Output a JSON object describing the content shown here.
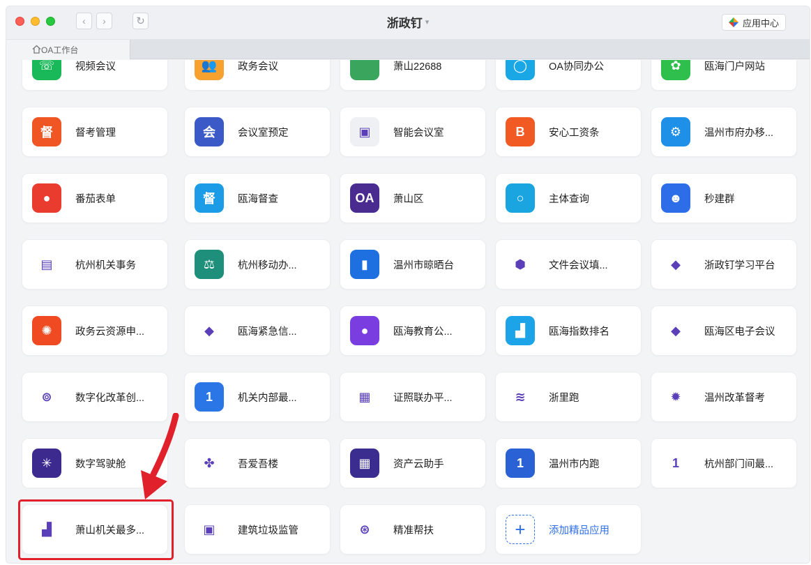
{
  "window": {
    "title": "浙政钉",
    "app_center_label": "应用中心",
    "nav_back": "‹",
    "nav_forward": "›",
    "nav_reload": "↻"
  },
  "tab": {
    "label": "OA工作台"
  },
  "colors": {
    "accent_blue": "#2f6fe8",
    "highlight_red": "#e0202a"
  },
  "apps": [
    {
      "label": "视频会议",
      "icon": "video-meeting-icon",
      "color": "#19b95a",
      "glyph": "☏"
    },
    {
      "label": "政务会议",
      "icon": "gov-meeting-icon",
      "color": "#f7a12e",
      "glyph": "👥"
    },
    {
      "label": "萧山22688",
      "icon": "xiaoshan-22688-icon",
      "color": "#3aa55d",
      "glyph": ""
    },
    {
      "label": "OA协同办公",
      "icon": "oa-collab-icon",
      "color": "#1aa7e6",
      "glyph": "◯"
    },
    {
      "label": "瓯海门户网站",
      "icon": "ouhai-portal-icon",
      "color": "#2fbf4c",
      "glyph": "✿"
    },
    {
      "label": "督考管理",
      "icon": "supervision-icon",
      "color": "#f05524",
      "glyph": "督"
    },
    {
      "label": "会议室预定",
      "icon": "meeting-room-icon",
      "color": "#3b5ac8",
      "glyph": "会"
    },
    {
      "label": "智能会议室",
      "icon": "smart-meeting-icon",
      "color": "#eef0f3",
      "glyph": "▣"
    },
    {
      "label": "安心工资条",
      "icon": "payslip-icon",
      "color": "#f25a24",
      "glyph": "B"
    },
    {
      "label": "温州市府办移...",
      "icon": "wenzhou-gov-icon",
      "color": "#1e90e8",
      "glyph": "⚙"
    },
    {
      "label": "番茄表单",
      "icon": "tomato-form-icon",
      "color": "#ea3b2f",
      "glyph": "●"
    },
    {
      "label": "瓯海督查",
      "icon": "ouhai-inspect-icon",
      "color": "#1c9be6",
      "glyph": "督"
    },
    {
      "label": "萧山区",
      "icon": "xiaoshan-district-icon",
      "color": "#4a2b8f",
      "glyph": "OA"
    },
    {
      "label": "主体查询",
      "icon": "entity-search-icon",
      "color": "#1aa5e0",
      "glyph": "○"
    },
    {
      "label": "秒建群",
      "icon": "quick-group-icon",
      "color": "#2d6ee8",
      "glyph": "☻"
    },
    {
      "label": "杭州机关事务",
      "icon": "hangzhou-affairs-icon",
      "color": "#ffffff",
      "glyph": "▤"
    },
    {
      "label": "杭州移动办...",
      "icon": "hangzhou-mobile-icon",
      "color": "#1d8f7a",
      "glyph": "⚖"
    },
    {
      "label": "温州市晾晒台",
      "icon": "wenzhou-display-icon",
      "color": "#1e6fe0",
      "glyph": "▮"
    },
    {
      "label": "文件会议填...",
      "icon": "file-meeting-icon",
      "color": "#ffffff",
      "glyph": "⬢"
    },
    {
      "label": "浙政钉学习平台",
      "icon": "learning-platform-icon",
      "color": "#ffffff",
      "glyph": "◆"
    },
    {
      "label": "政务云资源申...",
      "icon": "gov-cloud-icon",
      "color": "#ef4a21",
      "glyph": "✺"
    },
    {
      "label": "瓯海紧急信...",
      "icon": "ouhai-emergency-icon",
      "color": "#ffffff",
      "glyph": "◆"
    },
    {
      "label": "瓯海教育公...",
      "icon": "ouhai-education-icon",
      "color": "#7a3de0",
      "glyph": "●"
    },
    {
      "label": "瓯海指数排名",
      "icon": "ouhai-index-icon",
      "color": "#1ca3e8",
      "glyph": "▟"
    },
    {
      "label": "瓯海区电子会议",
      "icon": "ouhai-emeeting-icon",
      "color": "#ffffff",
      "glyph": "◆"
    },
    {
      "label": "数字化改革创...",
      "icon": "digital-reform-icon",
      "color": "#ffffff",
      "glyph": "⊚"
    },
    {
      "label": "机关内部最...",
      "icon": "agency-internal-icon",
      "color": "#2a76e6",
      "glyph": "1"
    },
    {
      "label": "证照联办平...",
      "icon": "license-platform-icon",
      "color": "#ffffff",
      "glyph": "▦"
    },
    {
      "label": "浙里跑",
      "icon": "zheli-run-icon",
      "color": "#ffffff",
      "glyph": "≋"
    },
    {
      "label": "温州改革督考",
      "icon": "wenzhou-reform-icon",
      "color": "#ffffff",
      "glyph": "✹"
    },
    {
      "label": "数字驾驶舱",
      "icon": "digital-cockpit-icon",
      "color": "#3d2a8f",
      "glyph": "✳"
    },
    {
      "label": "吾爱吾楼",
      "icon": "my-building-icon",
      "color": "#ffffff",
      "glyph": "✤"
    },
    {
      "label": "资产云助手",
      "icon": "asset-cloud-icon",
      "color": "#3a2d8f",
      "glyph": "▦"
    },
    {
      "label": "温州市内跑",
      "icon": "wenzhou-run-icon",
      "color": "#2a62d6",
      "glyph": "1"
    },
    {
      "label": "杭州部门间最...",
      "icon": "hangzhou-dept-icon",
      "color": "#ffffff",
      "glyph": "1"
    },
    {
      "label": "萧山机关最多...",
      "icon": "xiaoshan-agency-icon",
      "color": "#ffffff",
      "glyph": "▟"
    },
    {
      "label": "建筑垃圾监管",
      "icon": "construction-waste-icon",
      "color": "#ffffff",
      "glyph": "▣"
    },
    {
      "label": "精准帮扶",
      "icon": "precision-aid-icon",
      "color": "#ffffff",
      "glyph": "⊛"
    },
    {
      "label": "添加精品应用",
      "icon": "add-app-icon",
      "color": "#ffffff",
      "glyph": "+"
    }
  ]
}
